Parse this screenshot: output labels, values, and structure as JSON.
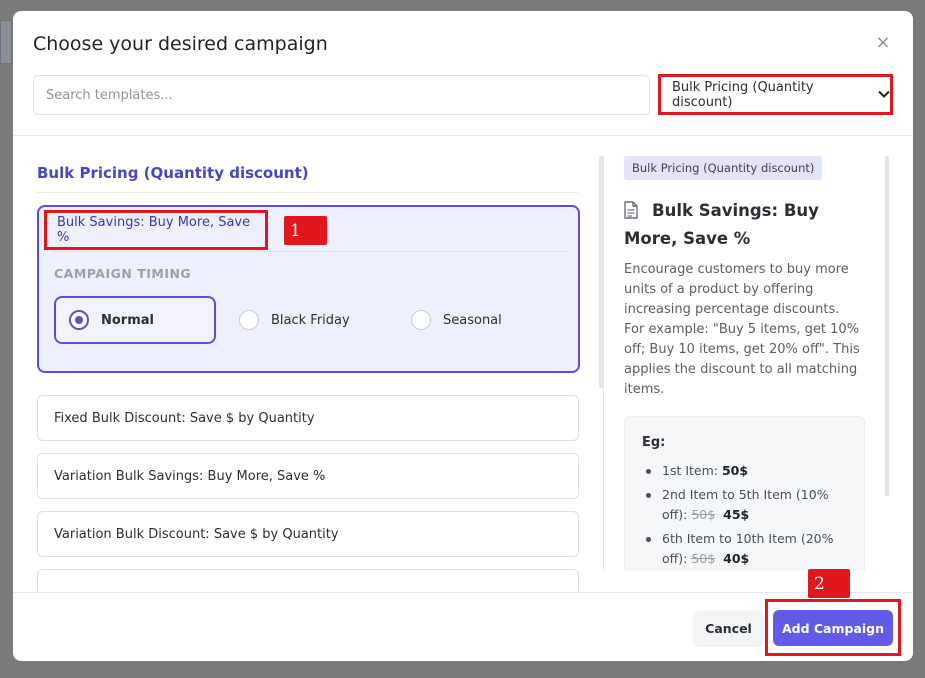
{
  "modal": {
    "title": "Choose your desired campaign",
    "close_label": "×"
  },
  "search": {
    "placeholder": "Search templates...",
    "value": ""
  },
  "type_select": {
    "selected": "Bulk Pricing (Quantity discount)",
    "chevron": "⌄"
  },
  "list": {
    "section_title": "Bulk Pricing (Quantity discount)",
    "active_card": {
      "title": "Bulk Savings: Buy More, Save %",
      "timing_label": "CAMPAIGN TIMING",
      "timing_options": [
        {
          "label": "Normal",
          "selected": true
        },
        {
          "label": "Black Friday",
          "selected": false
        },
        {
          "label": "Seasonal",
          "selected": false
        }
      ]
    },
    "cards": [
      {
        "title": "Fixed Bulk Discount: Save $ by Quantity"
      },
      {
        "title": "Variation Bulk Savings: Buy More, Save %"
      },
      {
        "title": "Variation Bulk Discount: Save $ by Quantity"
      },
      {
        "title": ""
      }
    ]
  },
  "annotations": {
    "step1": "1",
    "step2": "2"
  },
  "detail": {
    "tag": "Bulk Pricing (Quantity discount)",
    "icon": "document-icon",
    "title": "Bulk Savings: Buy More, Save %",
    "description": "Encourage customers to buy more units of a product by offering increasing percentage discounts. For example: \"Buy 5 items, get 10% off; Buy 10 items, get 20% off\". This applies the discount to all matching items.",
    "example_label": "Eg:",
    "examples": [
      {
        "text": "1st Item: ",
        "old_price": "",
        "price": "50$"
      },
      {
        "text": "2nd Item to 5th Item (10% off): ",
        "old_price": "50$",
        "price": "45$"
      },
      {
        "text": "6th Item to 10th Item (20% off): ",
        "old_price": "50$",
        "price": "40$"
      }
    ]
  },
  "footer": {
    "cancel_label": "Cancel",
    "add_label": "Add Campaign"
  },
  "colors": {
    "accent": "#5a4fd6",
    "primary_button": "#625ae8",
    "highlight_red": "#e0171c"
  }
}
